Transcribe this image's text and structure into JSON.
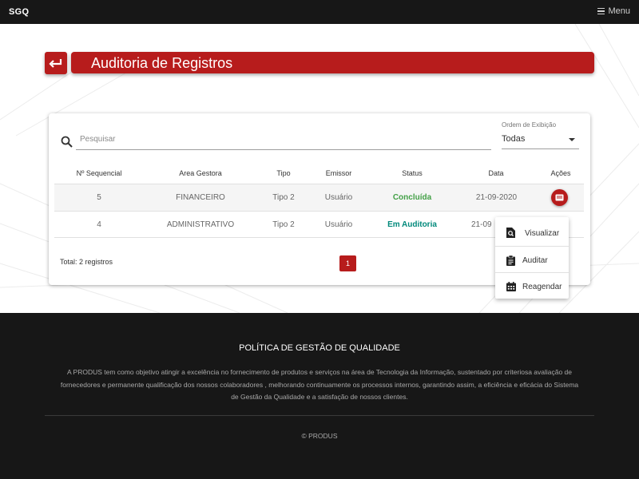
{
  "app": {
    "brand": "SGQ",
    "menu_label": "Menu"
  },
  "page": {
    "title": "Auditoria de Registros"
  },
  "search": {
    "placeholder": "Pesquisar",
    "value": ""
  },
  "order": {
    "label": "Ordem de Exibição",
    "selected": "Todas"
  },
  "table": {
    "headers": [
      "Nº Sequencial",
      "Area Gestora",
      "Tipo",
      "Emissor",
      "Status",
      "Data",
      "Ações"
    ],
    "rows": [
      {
        "seq": "5",
        "area": "FINANCEIRO",
        "tipo": "Tipo 2",
        "emissor": "Usuário",
        "status": "Concluída",
        "data": "21-09-2020"
      },
      {
        "seq": "4",
        "area": "ADMINISTRATIVO",
        "tipo": "Tipo 2",
        "emissor": "Usuário",
        "status": "Em Auditoria",
        "data": "21-09"
      }
    ]
  },
  "total": "Total: 2 registros",
  "pagination": {
    "current": "1"
  },
  "action_menu": {
    "items": [
      "Visualizar",
      "Auditar",
      "Reagendar"
    ]
  },
  "footer": {
    "title": "POLÍTICA DE GESTÃO DE QUALIDADE",
    "text": "A PRODUS tem como objetivo atingir a excelência no fornecimento de produtos e serviços na área de Tecnologia da Informação, sustentado por criteriosa avaliação de fornecedores e permanente qualificação dos nossos colaboradores , melhorando continuamente os processos internos, garantindo assim, a eficiência e eficácia do Sistema de Gestão da Qualidade e a satisfação de nossos clientes.",
    "copyright": "© PRODUS"
  },
  "colors": {
    "accent": "#b71c1c",
    "dark": "#171717",
    "status_done": "#43a047",
    "status_audit": "#00897b"
  }
}
